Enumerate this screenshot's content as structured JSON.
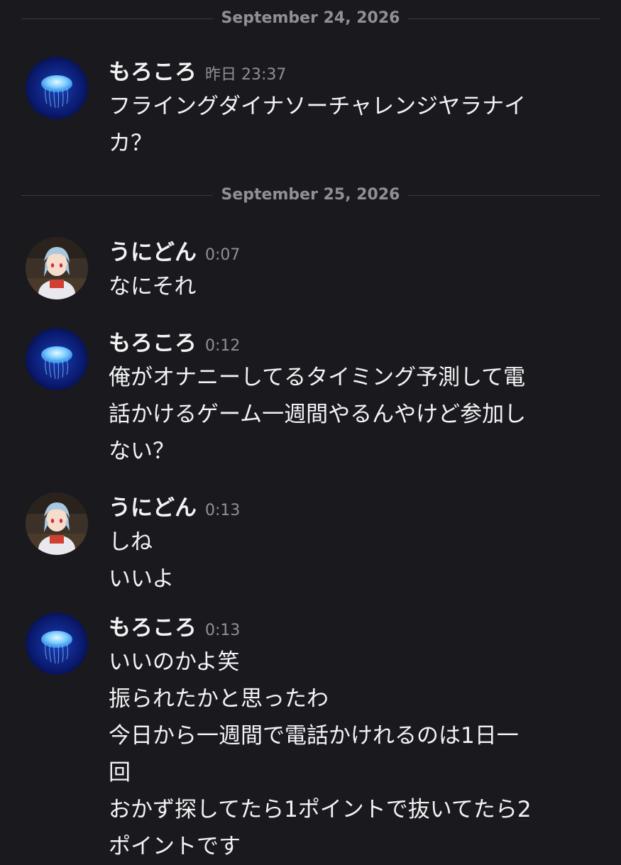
{
  "dividers": [
    {
      "date": "September 24, 2026"
    },
    {
      "date": "September 25, 2026"
    }
  ],
  "users": {
    "morokoro": {
      "name": "もろころ",
      "avatar_icon": "jellyfish-avatar-icon"
    },
    "unidon": {
      "name": "うにどん",
      "avatar_icon": "anime-character-avatar-icon"
    }
  },
  "messages": [
    {
      "author": "もろころ",
      "time": "昨日 23:37",
      "lines": [
        "フライングダイナソーチャレンジヤラナイ",
        "カ？"
      ]
    },
    {
      "author": "うにどん",
      "time": "0:07",
      "lines": [
        "なにそれ"
      ]
    },
    {
      "author": "もろころ",
      "time": "0:12",
      "lines": [
        "俺がオナニーしてるタイミング予測して電",
        "話かけるゲーム一週間やるんやけど参加し",
        "ない？"
      ]
    },
    {
      "author": "うにどん",
      "time": "0:13",
      "lines": [
        "しね",
        "いいよ"
      ]
    },
    {
      "author": "もろころ",
      "time": "0:13",
      "lines": [
        "いいのかよ笑",
        "振られたかと思ったわ",
        "今日から一週間で電話かけれるのは1日一",
        "回",
        "おかず探してたら1ポイントで抜いてたら2",
        "ポイントです"
      ]
    }
  ]
}
